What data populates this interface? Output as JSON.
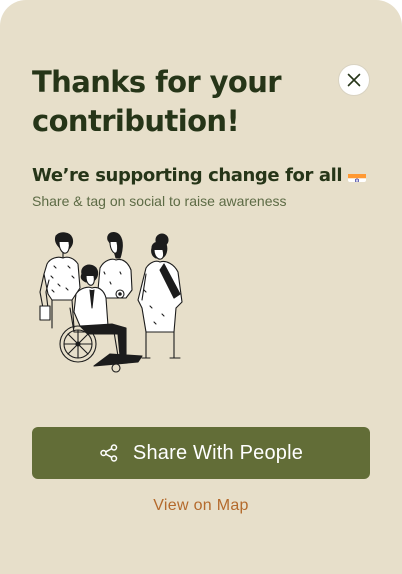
{
  "dialog": {
    "title": "Thanks for your contribution!",
    "subtitle": "We’re supporting change for all",
    "subtitle_flag": "india-flag-icon",
    "caption": "Share & tag on social to raise awareness",
    "close_icon": "close-icon",
    "illustration": "group-of-diverse-people-illustration",
    "share_button": {
      "label": "Share With People",
      "icon": "share-icon"
    },
    "map_link": "View on Map"
  },
  "colors": {
    "background": "#e7dfca",
    "title_text": "#263518",
    "caption_text": "#5d6b45",
    "primary_button": "#626d37",
    "link": "#b46a2c"
  }
}
